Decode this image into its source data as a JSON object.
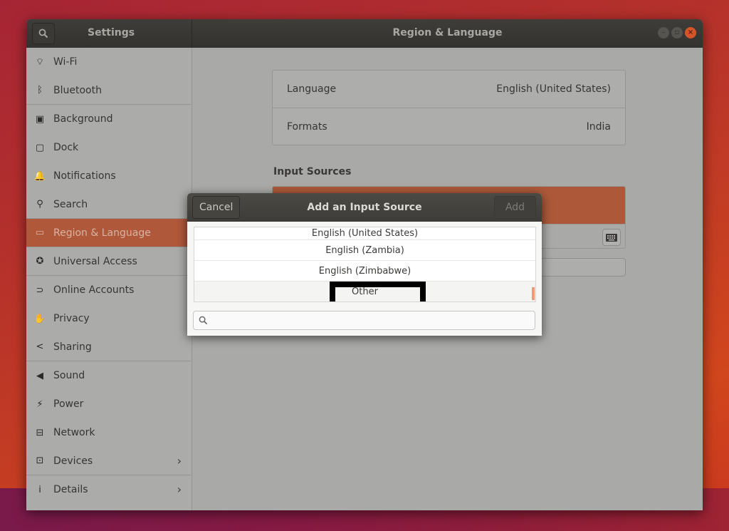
{
  "window": {
    "sidebar_title": "Settings",
    "panel_title": "Region & Language",
    "controls": {
      "minimize": "minimize-icon",
      "maximize": "maximize-icon",
      "close": "close-icon"
    }
  },
  "sidebar": {
    "items": [
      {
        "label": "Wi-Fi",
        "icon": "wifi-icon",
        "glyph": "⌔"
      },
      {
        "label": "Bluetooth",
        "icon": "bluetooth-icon",
        "glyph": "ᛒ"
      },
      {
        "label": "Background",
        "icon": "background-icon",
        "glyph": "▣"
      },
      {
        "label": "Dock",
        "icon": "dock-icon",
        "glyph": "▢"
      },
      {
        "label": "Notifications",
        "icon": "bell-icon",
        "glyph": "🔔"
      },
      {
        "label": "Search",
        "icon": "search-icon",
        "glyph": "⚲"
      },
      {
        "label": "Region & Language",
        "icon": "flag-icon",
        "glyph": "▭",
        "active": true
      },
      {
        "label": "Universal Access",
        "icon": "accessibility-icon",
        "glyph": "✪"
      },
      {
        "label": "Online Accounts",
        "icon": "online-accounts-icon",
        "glyph": "⊃"
      },
      {
        "label": "Privacy",
        "icon": "hand-icon",
        "glyph": "✋"
      },
      {
        "label": "Sharing",
        "icon": "share-icon",
        "glyph": "<"
      },
      {
        "label": "Sound",
        "icon": "speaker-icon",
        "glyph": "◀"
      },
      {
        "label": "Power",
        "icon": "power-icon",
        "glyph": "⚡"
      },
      {
        "label": "Network",
        "icon": "network-icon",
        "glyph": "⊟"
      },
      {
        "label": "Devices",
        "icon": "devices-icon",
        "glyph": "⊡",
        "chevron": "›"
      },
      {
        "label": "Details",
        "icon": "info-icon",
        "glyph": "i",
        "chevron": "›"
      }
    ]
  },
  "region": {
    "language_label": "Language",
    "language_value": "English (United States)",
    "formats_label": "Formats",
    "formats_value": "India",
    "input_sources_title": "Input Sources"
  },
  "dialog": {
    "title": "Add an Input Source",
    "cancel_label": "Cancel",
    "add_label": "Add",
    "items": [
      "English (United States)",
      "English (Zambia)",
      "English (Zimbabwe)",
      "Other"
    ],
    "search_value": "",
    "search_placeholder": ""
  }
}
